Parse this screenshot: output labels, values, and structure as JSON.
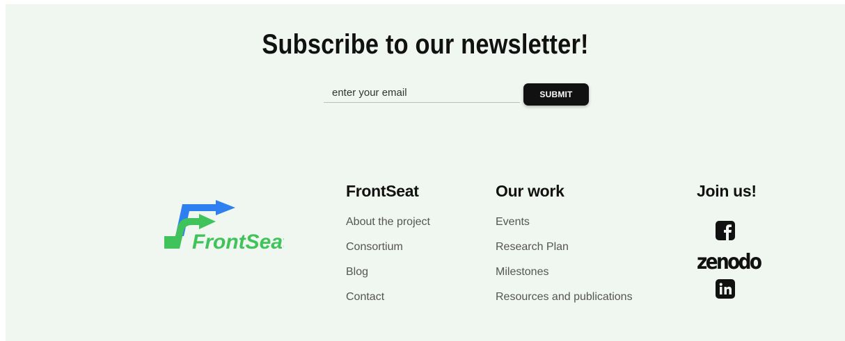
{
  "newsletter": {
    "title": "Subscribe to our newsletter!",
    "email_placeholder": "enter your email",
    "submit_label": "SUBMIT"
  },
  "logo": {
    "text": "FrontSeat",
    "colors": {
      "blue": "#2e7ff0",
      "green": "#3fc35a"
    }
  },
  "footer": {
    "frontseat": {
      "title": "FrontSeat",
      "links": [
        "About the project",
        "Consortium",
        "Blog",
        "Contact"
      ]
    },
    "our_work": {
      "title": "Our work",
      "links": [
        "Events",
        "Research Plan",
        "Milestones",
        "Resources and publications"
      ]
    },
    "join_us": {
      "title": "Join us!",
      "social": [
        {
          "name": "facebook",
          "icon": "facebook-icon"
        },
        {
          "name": "zenodo",
          "label": "zenodo",
          "icon": "zenodo-logo"
        },
        {
          "name": "linkedin",
          "icon": "linkedin-icon"
        }
      ]
    }
  }
}
